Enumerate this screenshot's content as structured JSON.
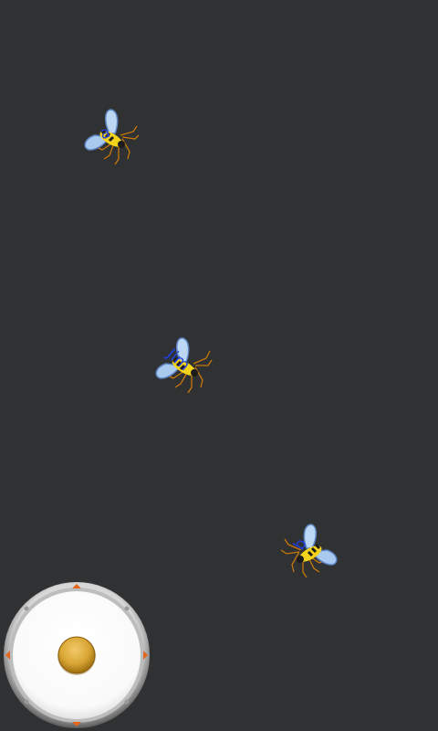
{
  "bees": [
    {
      "label": "a"
    },
    {
      "label": "Jim"
    },
    {
      "label": "b"
    }
  ],
  "colors": {
    "background": "#2f3133",
    "label_text": "#2240e0",
    "wing": "#a9c9ef",
    "body_yellow": "#f2d21a",
    "body_black": "#1c1c1c",
    "legs": "#c8780a",
    "joystick_knob": "#d9a634",
    "joystick_arrow": "#e2661c"
  },
  "icons": {
    "bee": "bee-icon",
    "joystick": "joystick-icon"
  }
}
